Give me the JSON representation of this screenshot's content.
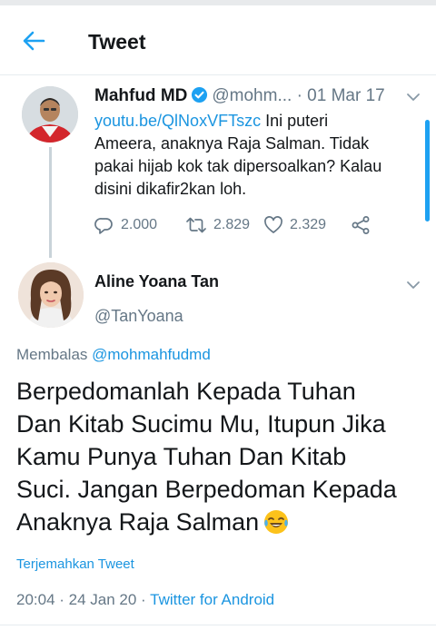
{
  "header": {
    "title": "Tweet",
    "back_icon": "arrow-left-icon"
  },
  "colors": {
    "accent": "#1da1f2",
    "link": "#1b95e0",
    "muted": "#657786",
    "text": "#14171a"
  },
  "parent_tweet": {
    "name": "Mahfud MD",
    "handle": "@mohm...",
    "date": "· 01 Mar 17",
    "link": "youtu.be/QlNoxVFTszc",
    "text_1": " Ini puteri",
    "text_2": "Ameera, anaknya Raja Salman. Tidak",
    "text_3": "pakai hijab kok tak dipersoalkan? Kalau",
    "text_4": "disini dikafir2kan loh.",
    "replies": "2.000",
    "retweets": "2.829",
    "likes": "2.329"
  },
  "reply_tweet": {
    "name": "Aline Yoana Tan",
    "handle": "@TanYoana",
    "replying_prefix": "Membalas ",
    "replying_to": "@mohmahfudmd",
    "line_1": "Berpedomanlah Kepada Tuhan",
    "line_2": "Dan Kitab Sucimu Mu, Itupun Jika",
    "line_3": "Kamu Punya Tuhan Dan Kitab",
    "line_4": "Suci. Jangan Berpedoman Kepada",
    "line_5": "Anaknya Raja Salman",
    "emoji": "face-with-tears-of-joy",
    "translate": "Terjemahkan Tweet",
    "time": "20:04 · 24 Jan 20 · ",
    "source": "Twitter for Android"
  }
}
